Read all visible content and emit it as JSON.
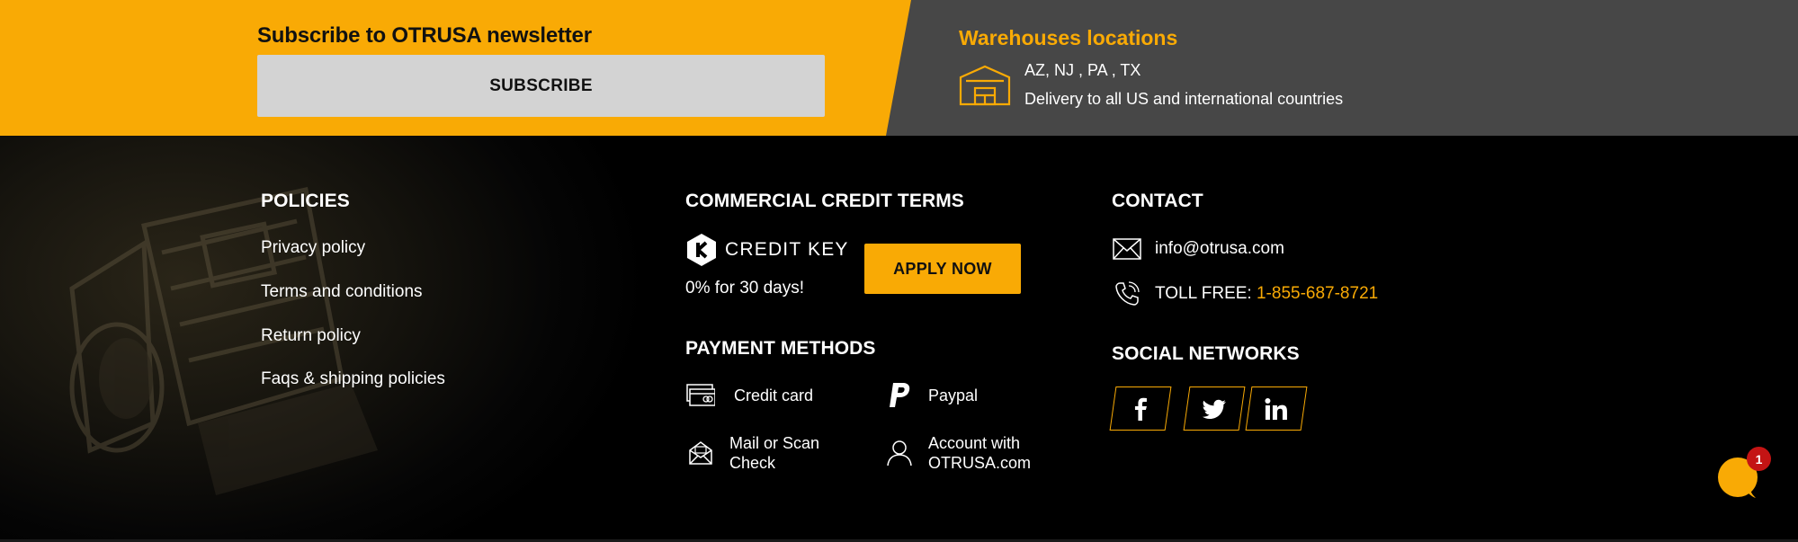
{
  "newsletter": {
    "title": "Subscribe to OTRUSA newsletter",
    "button_label": "SUBSCRIBE"
  },
  "warehouses": {
    "title": "Warehouses locations",
    "states": "AZ, NJ , PA , TX",
    "delivery": "Delivery to all US and international countries",
    "icon": "warehouse-icon"
  },
  "policies": {
    "title": "POLICIES",
    "links": [
      "Privacy policy",
      "Terms and conditions",
      "Return policy",
      "Faqs & shipping policies"
    ]
  },
  "credit": {
    "title": "COMMERCIAL CREDIT TERMS",
    "logo_text": "CREDIT KEY",
    "offer": "0% for 30 days!",
    "apply_label": "APPLY NOW"
  },
  "payment": {
    "title": "PAYMENT METHODS",
    "methods": [
      {
        "label": "Credit card",
        "icon": "credit-card-icon"
      },
      {
        "label": "Paypal",
        "icon": "paypal-icon"
      },
      {
        "label": "Mail or Scan Check",
        "line1": "Mail or Scan",
        "line2": "Check",
        "icon": "mail-check-icon"
      },
      {
        "label": "Account with OTRUSA.com",
        "line1": "Account with",
        "line2": "OTRUSA.com",
        "icon": "user-account-icon"
      }
    ]
  },
  "contact": {
    "title": "CONTACT",
    "email": "info@otrusa.com",
    "toll_label": "TOLL FREE: ",
    "phone": "1-855-687-8721"
  },
  "social": {
    "title": "SOCIAL NETWORKS",
    "networks": [
      "facebook-icon",
      "twitter-icon",
      "linkedin-icon"
    ]
  },
  "chat": {
    "badge_count": "1"
  },
  "colors": {
    "accent": "#f9aa05",
    "dark_band": "#474747",
    "background": "#000000",
    "badge": "#c41414"
  }
}
